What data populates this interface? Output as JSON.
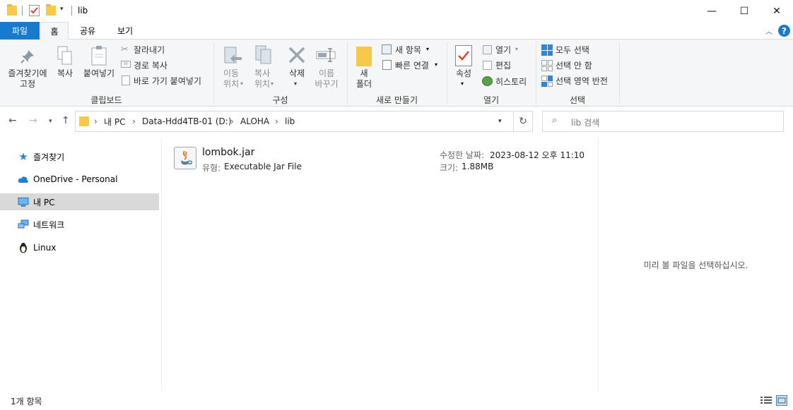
{
  "window": {
    "title": "lib",
    "minimize_glyph": "—",
    "maximize_glyph": "☐",
    "close_glyph": "✕"
  },
  "ribbon_tabs": [
    "파일",
    "홈",
    "공유",
    "보기"
  ],
  "ribbon": {
    "clipboard": {
      "pin_label_1": "즐겨찾기에",
      "pin_label_2": "고정",
      "copy_label": "복사",
      "paste_label": "붙여넣기",
      "cut_label": "잘라내기",
      "copy_path_label": "경로 복사",
      "paste_shortcut_label": "바로 가기 붙여넣기",
      "group_label": "클립보드"
    },
    "organize": {
      "move_label_1": "이동",
      "move_label_2": "위치",
      "copyto_label_1": "복사",
      "copyto_label_2": "위치",
      "delete_label": "삭제",
      "rename_label_1": "이름",
      "rename_label_2": "바꾸기",
      "group_label": "구성"
    },
    "new": {
      "new_folder_label_1": "새",
      "new_folder_label_2": "폴더",
      "new_item_label": "새 항목",
      "easy_access_label": "빠른 연결",
      "group_label": "새로 만들기"
    },
    "open": {
      "properties_label": "속성",
      "open_label": "열기",
      "edit_label": "편집",
      "history_label": "히스토리",
      "group_label": "열기"
    },
    "select": {
      "select_all_label": "모두 선택",
      "select_none_label": "선택 안 함",
      "invert_label": "선택 영역 반전",
      "group_label": "선택"
    }
  },
  "address": {
    "crumbs": [
      "내 PC",
      "Data-Hdd4TB-01 (D:)",
      "ALOHA",
      "lib"
    ],
    "search_placeholder": "lib 검색"
  },
  "nav": {
    "quick_access": "즐겨찾기",
    "onedrive": "OneDrive - Personal",
    "this_pc": "내 PC",
    "network": "네트워크",
    "linux": "Linux"
  },
  "file": {
    "name": "lombok.jar",
    "type_label": "유형:",
    "type_value": "Executable Jar File",
    "modified_label": "수정한 날짜:",
    "modified_value": "2023-08-12 오후 11:10",
    "size_label": "크기:",
    "size_value": "1.88MB"
  },
  "preview_text": "미리 볼 파일을 선택하십시오.",
  "status_text": "1개 항목",
  "colors": {
    "accent": "#1979ca",
    "selected_nav": "#d9d9d9",
    "folder": "#f6c94a",
    "help": "#1979ca"
  }
}
